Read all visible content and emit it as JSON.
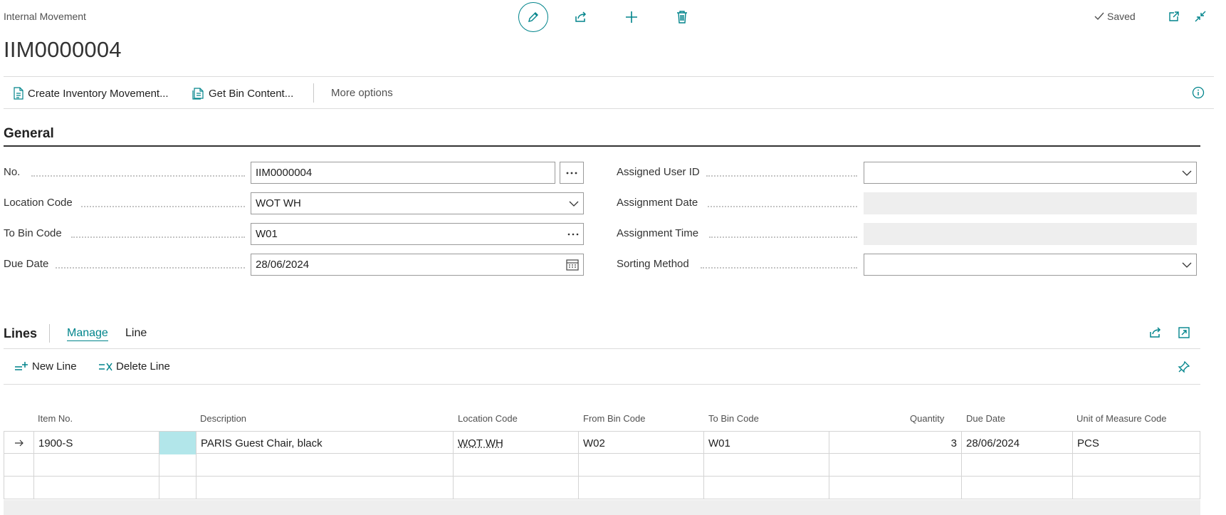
{
  "header": {
    "caption": "Internal Movement",
    "title": "IIM0000004",
    "status": "Saved"
  },
  "actions": {
    "create_inventory_movement": "Create Inventory Movement...",
    "get_bin_content": "Get Bin Content...",
    "more_options": "More options"
  },
  "general": {
    "title": "General",
    "fields": {
      "no": {
        "label": "No.",
        "value": "IIM0000004"
      },
      "location_code": {
        "label": "Location Code",
        "value": "WOT WH"
      },
      "to_bin_code": {
        "label": "To Bin Code",
        "value": "W01"
      },
      "due_date": {
        "label": "Due Date",
        "value": "28/06/2024"
      },
      "assigned_user_id": {
        "label": "Assigned User ID",
        "value": ""
      },
      "assignment_date": {
        "label": "Assignment Date",
        "value": ""
      },
      "assignment_time": {
        "label": "Assignment Time",
        "value": ""
      },
      "sorting_method": {
        "label": "Sorting Method",
        "value": ""
      }
    }
  },
  "lines": {
    "title": "Lines",
    "tabs": {
      "manage": "Manage",
      "line": "Line"
    },
    "actions": {
      "new_line": "New Line",
      "delete_line": "Delete Line"
    },
    "columns": {
      "item_no": "Item No.",
      "description": "Description",
      "location_code": "Location Code",
      "from_bin_code": "From Bin Code",
      "to_bin_code": "To Bin Code",
      "quantity": "Quantity",
      "due_date": "Due Date",
      "unit_of_measure_code": "Unit of Measure Code"
    },
    "rows": [
      {
        "item_no": "1900-S",
        "description": "PARIS Guest Chair, black",
        "location_code": "WOT WH",
        "from_bin_code": "W02",
        "to_bin_code": "W01",
        "quantity": "3",
        "due_date": "28/06/2024",
        "unit_of_measure_code": "PCS"
      }
    ]
  },
  "colors": {
    "accent": "#00848b",
    "selection": "#b2e6ea",
    "text": "#212121"
  },
  "icons": {
    "edit": "pencil-icon",
    "share": "share-icon",
    "new": "plus-icon",
    "delete": "trash-icon",
    "open_new_window": "open-new-window-icon",
    "collapse": "collapse-icon",
    "info": "info-icon",
    "calendar": "calendar-icon",
    "chevron": "chevron-down-icon",
    "arrow": "row-arrow-icon"
  }
}
